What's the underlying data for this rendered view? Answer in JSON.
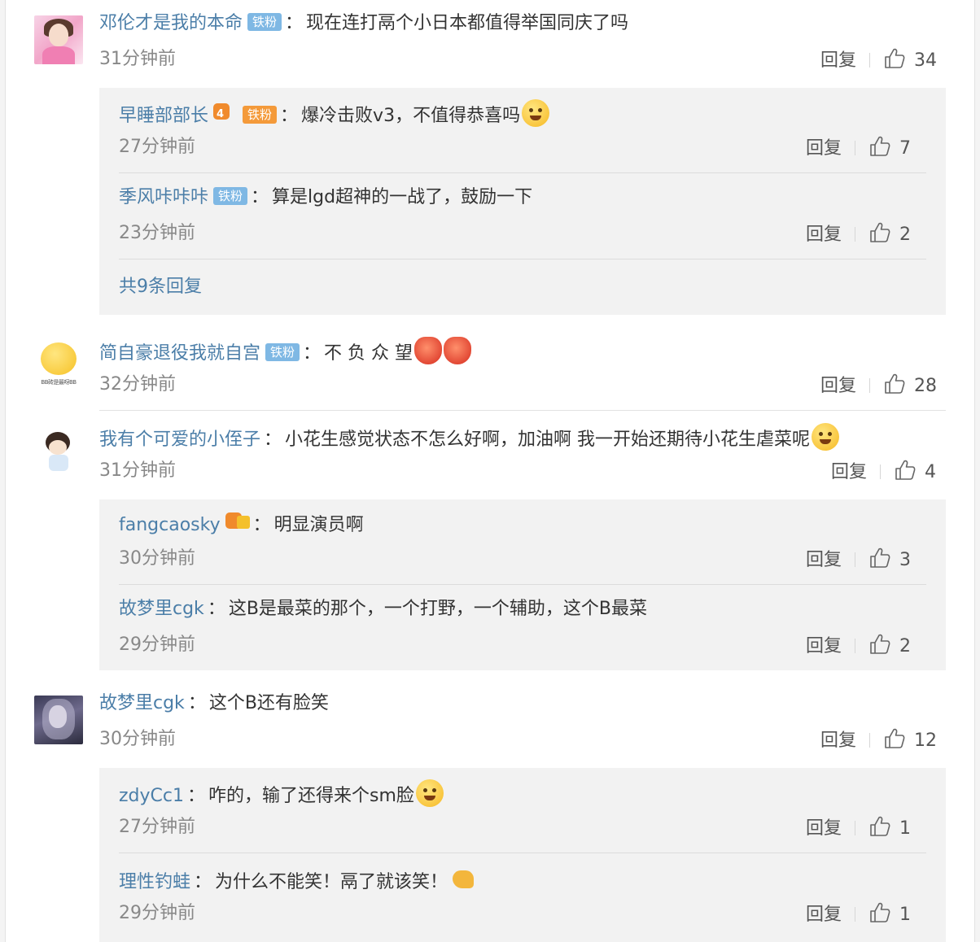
{
  "labels": {
    "reply": "回复",
    "colon": "："
  },
  "colors": {
    "username": "#4b7ea8",
    "badge": "#7fb8e4",
    "panel": "#f2f2f2"
  },
  "icons": {
    "like": "thumbs-up-icon"
  },
  "comments": [
    {
      "user": "邓伦才是我的本命",
      "badge": "铁粉",
      "text": "现在连打鬲个小日本都值得举国同庆了吗",
      "time": "31分钟前",
      "likes": "34",
      "replies": [
        {
          "user": "早睡部部长",
          "badge": "铁粉",
          "text": "爆冷击败v3，不值得恭喜吗",
          "time": "27分钟前",
          "likes": "7"
        },
        {
          "user": "季风咔咔咔",
          "badge": "铁粉",
          "text": "算是lgd超神的一战了，鼓励一下",
          "time": "23分钟前",
          "likes": "2"
        }
      ],
      "more": "共9条回复"
    },
    {
      "user": "简自豪退役我就自宫",
      "badge": "铁粉",
      "text": "不 负 众 望",
      "avatar_caption": "BB砖是最呀BB",
      "time": "32分钟前",
      "likes": "28"
    },
    {
      "user": "我有个可爱的小侄子",
      "text": "小花生感觉状态不怎么好啊，加油啊 我一开始还期待小花生虐菜呢",
      "time": "31分钟前",
      "likes": "4",
      "replies": [
        {
          "user": "fangcaosky",
          "text": "明显演员啊",
          "time": "30分钟前",
          "likes": "3"
        },
        {
          "user": "故梦里cgk",
          "text": "这B是最菜的那个，一个打野，一个辅助，这个B最菜",
          "time": "29分钟前",
          "likes": "2"
        }
      ]
    },
    {
      "user": "故梦里cgk",
      "text": "这个B还有脸笑",
      "time": "30分钟前",
      "likes": "12",
      "replies": [
        {
          "user": "zdyCc1",
          "text": "咋的，输了还得来个sm脸",
          "time": "27分钟前",
          "likes": "1"
        },
        {
          "user": "理性钓蛙",
          "text": "为什么不能笑！鬲了就该笑！",
          "time": "29分钟前",
          "likes": "1"
        }
      ]
    }
  ]
}
